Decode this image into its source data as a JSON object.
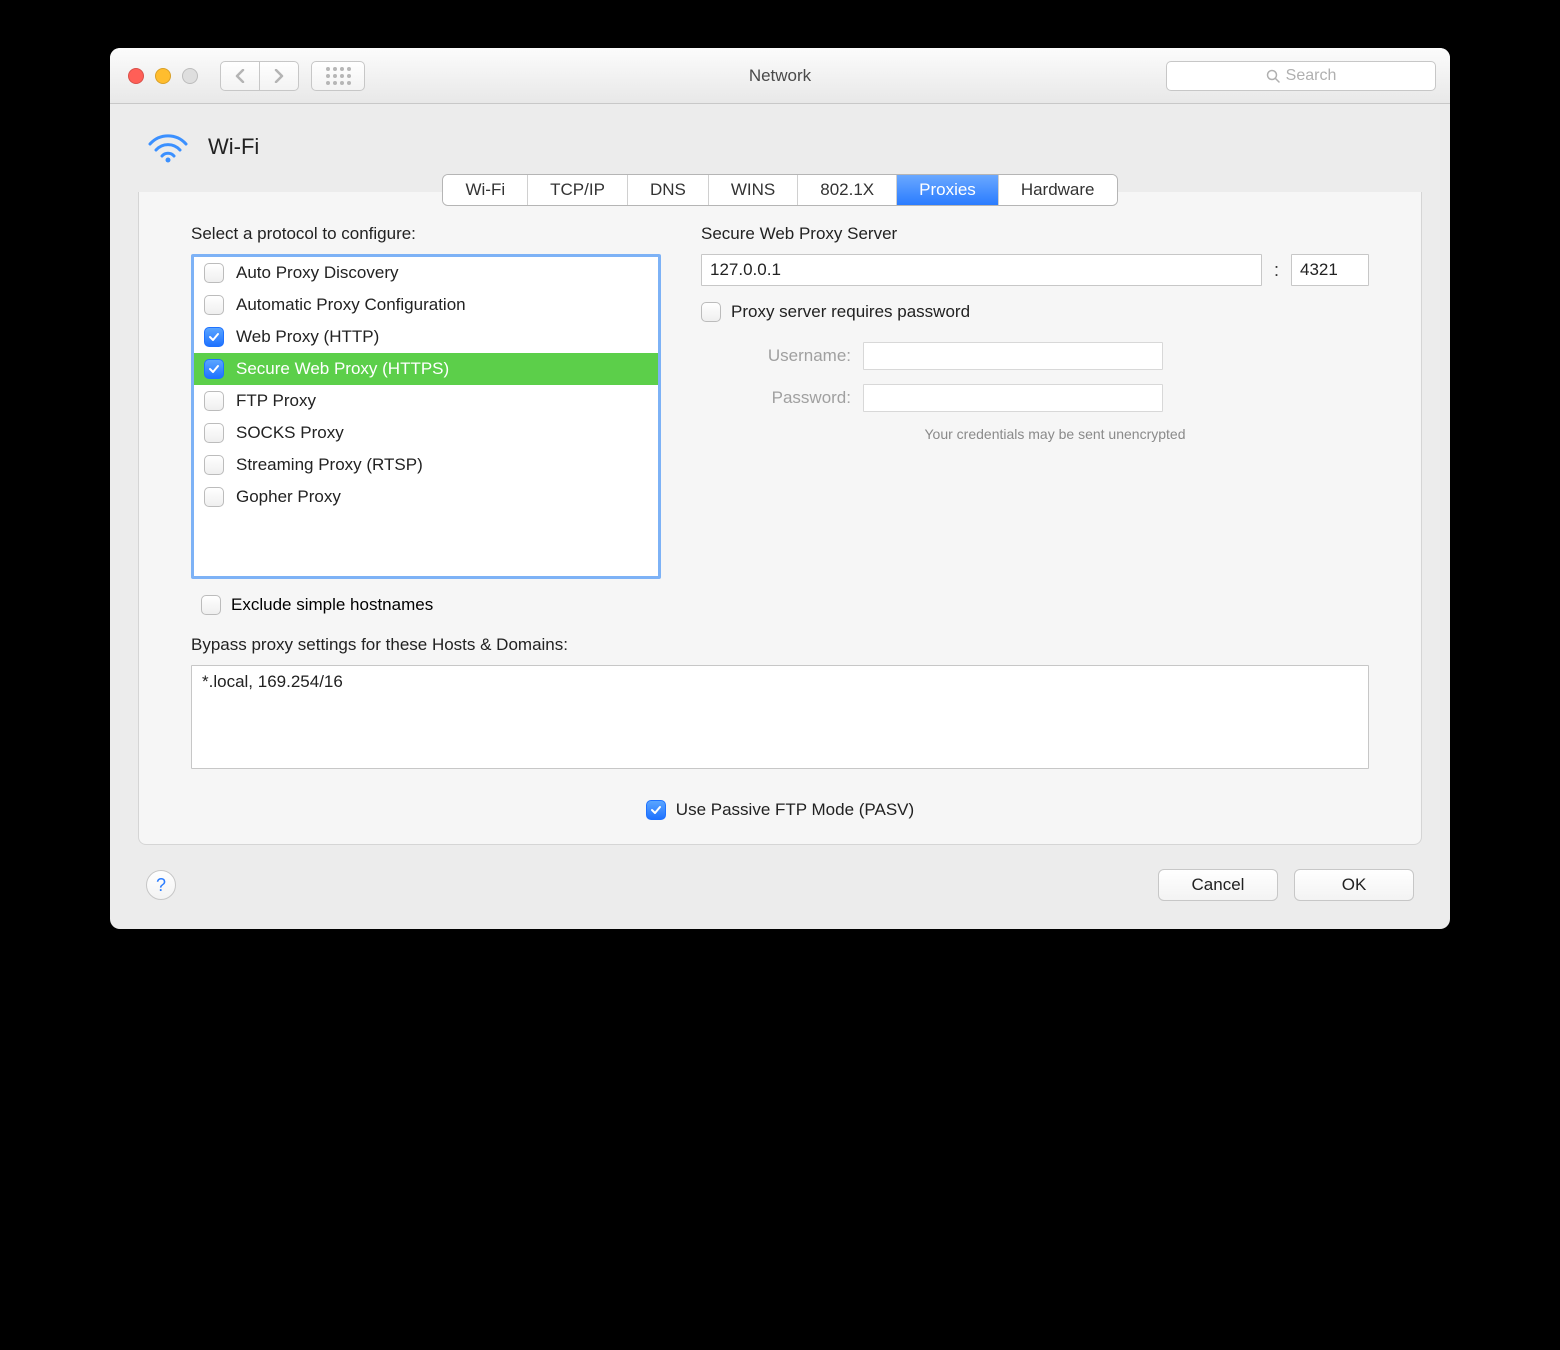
{
  "window": {
    "title": "Network",
    "search_placeholder": "Search"
  },
  "interface": {
    "name": "Wi-Fi"
  },
  "tabs": [
    {
      "label": "Wi-Fi"
    },
    {
      "label": "TCP/IP"
    },
    {
      "label": "DNS"
    },
    {
      "label": "WINS"
    },
    {
      "label": "802.1X"
    },
    {
      "label": "Proxies",
      "active": true
    },
    {
      "label": "Hardware"
    }
  ],
  "proxies": {
    "protocol_label": "Select a protocol to configure:",
    "protocols": [
      {
        "label": "Auto Proxy Discovery",
        "checked": false
      },
      {
        "label": "Automatic Proxy Configuration",
        "checked": false
      },
      {
        "label": "Web Proxy (HTTP)",
        "checked": true
      },
      {
        "label": "Secure Web Proxy (HTTPS)",
        "checked": true,
        "selected": true
      },
      {
        "label": "FTP Proxy",
        "checked": false
      },
      {
        "label": "SOCKS Proxy",
        "checked": false
      },
      {
        "label": "Streaming Proxy (RTSP)",
        "checked": false
      },
      {
        "label": "Gopher Proxy",
        "checked": false
      }
    ],
    "server_label": "Secure Web Proxy Server",
    "server_host": "127.0.0.1",
    "server_port": "4321",
    "requires_password_label": "Proxy server requires password",
    "requires_password_checked": false,
    "username_label": "Username:",
    "password_label": "Password:",
    "username_value": "",
    "password_value": "",
    "credentials_hint": "Your credentials may be sent unencrypted",
    "exclude_simple_label": "Exclude simple hostnames",
    "exclude_simple_checked": false,
    "bypass_label": "Bypass proxy settings for these Hosts & Domains:",
    "bypass_value": "*.local, 169.254/16",
    "pasv_label": "Use Passive FTP Mode (PASV)",
    "pasv_checked": true
  },
  "footer": {
    "cancel": "Cancel",
    "ok": "OK"
  },
  "colon": ":"
}
